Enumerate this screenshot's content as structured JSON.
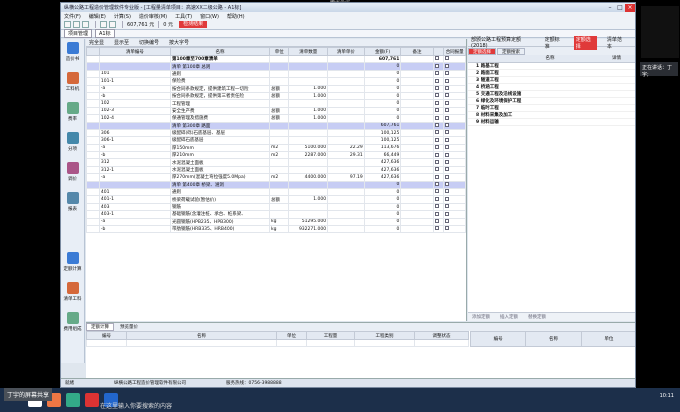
{
  "meeting": {
    "title": "腾讯会议",
    "speaking": "正在讲话：丁宇;",
    "share_label": "丁宇的屏幕共享",
    "search_hint": "在这里输入你要搜索的内容"
  },
  "app": {
    "title": "纵横公路工程造价管理软件专业版 - [工程量清单项目：高速XX二级公路 - A1标]"
  },
  "menu": [
    "文件(F)",
    "编辑(E)",
    "计算(S)",
    "造价审核(M)",
    "工具(T)",
    "窗口(W)",
    "帮助(H)"
  ],
  "toolbar": {
    "money": "607,761 元",
    "money2": "0 元",
    "red_btn": "检测结果"
  },
  "project_tabs": [
    "项目管理",
    "A1标"
  ],
  "subbar": {
    "items": [
      "完全显",
      "显示至",
      "切换编号",
      "按大字号"
    ],
    "std_label": "部颁公路工程预算定额(2018)",
    "btn1": "定额标准",
    "btn2": "定额选择",
    "btn3": "清单范本"
  },
  "sidebar": [
    "造价书",
    "工料机",
    "费率",
    "分项",
    "调价",
    "报表"
  ],
  "sidebar2": [
    "定额计算",
    "清单工料",
    "费用组成"
  ],
  "table": {
    "headers": [
      "",
      "清单编号",
      "名称",
      "单位",
      "清单数量",
      "清单单价",
      "金额(F)",
      "备注",
      "",
      "合同报量"
    ],
    "rows": [
      {
        "no": "",
        "name": "第100章至700章清单",
        "unit": "",
        "qty": "",
        "price": "",
        "amt": "607,761",
        "bold": true,
        "hl": false
      },
      {
        "no": "",
        "name": "清单 第100章 总则",
        "unit": "",
        "qty": "",
        "price": "",
        "amt": "0",
        "bold": false,
        "hl": true
      },
      {
        "no": "101",
        "name": "通则",
        "unit": "",
        "qty": "",
        "price": "",
        "amt": "0",
        "bold": false,
        "hl": false
      },
      {
        "no": "101-1",
        "name": "保险费",
        "unit": "",
        "qty": "",
        "price": "",
        "amt": "0",
        "bold": false,
        "hl": false
      },
      {
        "no": "-a",
        "name": "按合同条款规定，提供建筑工程一切险",
        "unit": "总额",
        "qty": "1.000",
        "price": "",
        "amt": "0",
        "bold": false,
        "hl": false
      },
      {
        "no": "-b",
        "name": "按合同条款规定，提供第三者责任险",
        "unit": "总额",
        "qty": "1.000",
        "price": "",
        "amt": "0",
        "bold": false,
        "hl": false
      },
      {
        "no": "102",
        "name": "工程管理",
        "unit": "",
        "qty": "",
        "price": "",
        "amt": "0",
        "bold": false,
        "hl": false
      },
      {
        "no": "102-3",
        "name": "安全生产费",
        "unit": "总额",
        "qty": "1.000",
        "price": "",
        "amt": "0",
        "bold": false,
        "hl": false
      },
      {
        "no": "102-4",
        "name": "保通管理及措施费",
        "unit": "总额",
        "qty": "1.000",
        "price": "",
        "amt": "0",
        "bold": false,
        "hl": false
      },
      {
        "no": "",
        "name": "清单 第300章 路面",
        "unit": "",
        "qty": "",
        "price": "",
        "amt": "607,761",
        "bold": false,
        "hl": true
      },
      {
        "no": "306",
        "name": "级配碎(砾)石底基层、基层",
        "unit": "",
        "qty": "",
        "price": "",
        "amt": "100,125",
        "bold": false,
        "hl": false
      },
      {
        "no": "306-1",
        "name": "级配碎石底基层",
        "unit": "",
        "qty": "",
        "price": "",
        "amt": "100,125",
        "bold": false,
        "hl": false
      },
      {
        "no": "-a",
        "name": "厚150mm",
        "unit": "m2",
        "qty": "5100.000",
        "price": "22.29",
        "amt": "113,676",
        "bold": false,
        "hl": false
      },
      {
        "no": "-b",
        "name": "厚210mm",
        "unit": "m2",
        "qty": "2287.000",
        "price": "29.31",
        "amt": "66,449",
        "bold": false,
        "hl": false
      },
      {
        "no": "312",
        "name": "水泥混凝土面板",
        "unit": "",
        "qty": "",
        "price": "",
        "amt": "427,636",
        "bold": false,
        "hl": false
      },
      {
        "no": "312-1",
        "name": "水泥混凝土面板",
        "unit": "",
        "qty": "",
        "price": "",
        "amt": "427,636",
        "bold": false,
        "hl": false
      },
      {
        "no": "-a",
        "name": "厚270mm(混凝土弯拉强度5.0Mpa)",
        "unit": "m2",
        "qty": "4400.000",
        "price": "97.19",
        "amt": "427,636",
        "bold": false,
        "hl": false
      },
      {
        "no": "",
        "name": "清单 第400章 桥梁、涵洞",
        "unit": "",
        "qty": "",
        "price": "",
        "amt": "0",
        "bold": false,
        "hl": true
      },
      {
        "no": "401",
        "name": "通则",
        "unit": "",
        "qty": "",
        "price": "",
        "amt": "0",
        "bold": false,
        "hl": false
      },
      {
        "no": "401-1",
        "name": "桥梁荷载试验(暂估价)",
        "unit": "总额",
        "qty": "1.000",
        "price": "",
        "amt": "0",
        "bold": false,
        "hl": false
      },
      {
        "no": "403",
        "name": "钢筋",
        "unit": "",
        "qty": "",
        "price": "",
        "amt": "0",
        "bold": false,
        "hl": false
      },
      {
        "no": "403-1",
        "name": "基础钢筋(含灌注桩、承台、桩系梁、",
        "unit": "",
        "qty": "",
        "price": "",
        "amt": "0",
        "bold": false,
        "hl": false
      },
      {
        "no": "-a",
        "name": "光圆钢筋(HPB235、HPB300)",
        "unit": "kg",
        "qty": "51295.000",
        "price": "",
        "amt": "0",
        "bold": false,
        "hl": false
      },
      {
        "no": "-b",
        "name": "带肋钢筋(HRB335、HRB400)",
        "unit": "kg",
        "qty": "932271.000",
        "price": "",
        "amt": "0",
        "bold": false,
        "hl": false
      }
    ]
  },
  "right": {
    "tabs": [
      "定额选择",
      "定额搜索"
    ],
    "header": [
      "",
      "名称",
      "详情"
    ],
    "items": [
      "1 路基工程",
      "2 路面工程",
      "3 隧道工程",
      "4 桥涵工程",
      "5 交通工程及沿线设施",
      "6 绿化及环境保护工程",
      "7 临时工程",
      "8 材料采集及加工",
      "9 材料运输"
    ],
    "btns": [
      "添加定额",
      "插入定额",
      "替换定额"
    ]
  },
  "bottom": {
    "tabs": [
      "定额计算",
      "预览量价"
    ],
    "left_headers": [
      "编号",
      "名称",
      "单位",
      "工程量",
      "工程类别",
      "调整状态"
    ],
    "right_headers": [
      "编号",
      "名称",
      "单位"
    ]
  },
  "status": [
    "就绪",
    "纵横公路工程造价管理软件有限公司",
    "服务热线：0756-3988888"
  ],
  "clock": {
    "time": "10:11",
    "date": "2021/04/..."
  }
}
